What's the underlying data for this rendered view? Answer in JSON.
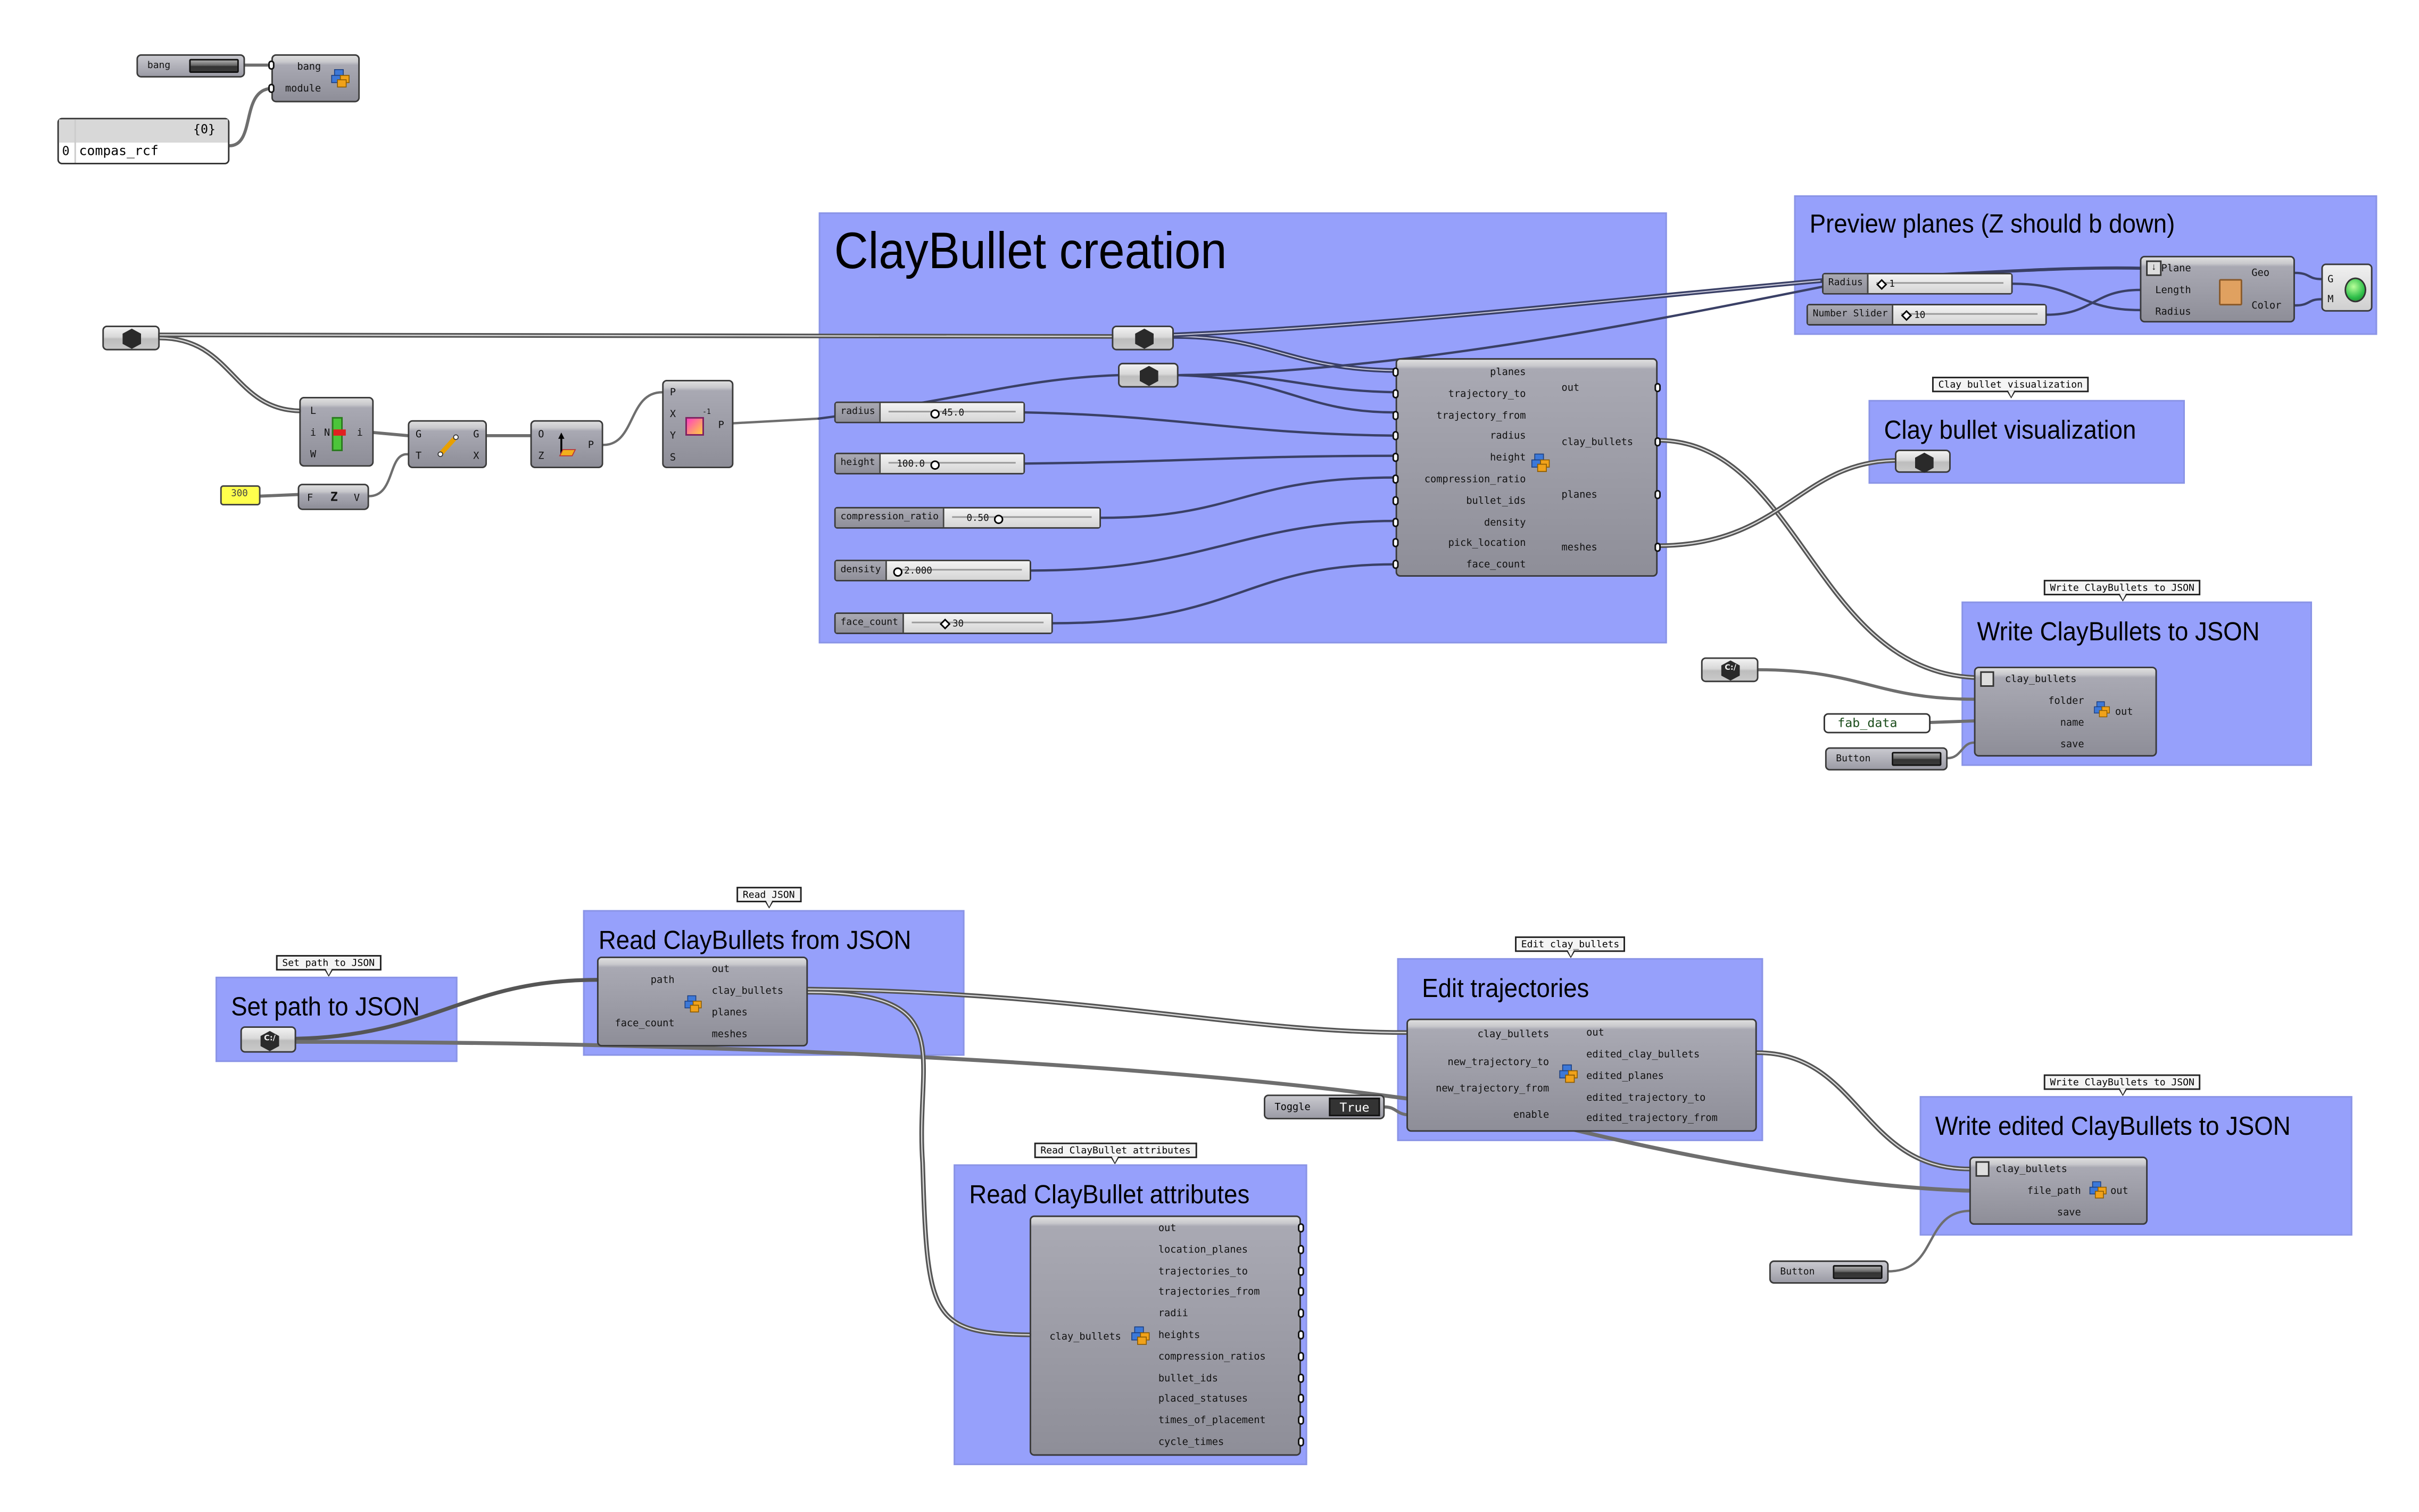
{
  "canvas": {
    "group_color": "#96a0fb",
    "wire_color": "#3a4066",
    "wire_color_outside": "#6e6e6e"
  },
  "top_left": {
    "bang_button_label": "bang",
    "python_node": {
      "inputs": [
        "bang",
        "module"
      ]
    },
    "panel": {
      "header": "{0}",
      "index": "0",
      "value": "compas_rcf"
    }
  },
  "geometry_chain": {
    "list_item": {
      "inputs": [
        "L",
        "i",
        "W"
      ],
      "outputs": [
        "i"
      ],
      "center_glyph": "N"
    },
    "orient": {
      "inputs": [
        "G",
        "T"
      ],
      "outputs": [
        "G",
        "X"
      ]
    },
    "plane": {
      "inputs": [
        "O",
        "Z"
      ],
      "outputs": [
        "P"
      ]
    },
    "adjust_plane": {
      "inputs": [
        "P",
        "X",
        "Y",
        "S"
      ],
      "outputs": [
        "P"
      ],
      "badge": "-1"
    },
    "unit_z": {
      "inputs": [
        "F"
      ],
      "outputs": [
        "V"
      ],
      "glyph": "Z"
    },
    "number_panel_value": "300"
  },
  "groups": {
    "claybullet_creation": {
      "title": "ClayBullet creation",
      "sliders": [
        {
          "name": "radius",
          "value": "45.0",
          "marker": "knob"
        },
        {
          "name": "height",
          "value": "100.0",
          "marker": "knob"
        },
        {
          "name": "compression_ratio",
          "value": "0.50",
          "marker": "knob"
        },
        {
          "name": "density",
          "value": "2.000",
          "marker": "knob"
        },
        {
          "name": "face_count",
          "value": "30",
          "marker": "diamond"
        }
      ],
      "python_node": {
        "inputs": [
          "planes",
          "trajectory_to",
          "trajectory_from",
          "radius",
          "height",
          "compression_ratio",
          "bullet_ids",
          "density",
          "pick_location",
          "face_count"
        ],
        "outputs": [
          "out",
          "clay_bullets",
          "planes",
          "meshes"
        ]
      }
    },
    "preview_planes": {
      "title": "Preview planes (Z should b down)",
      "sliders": [
        {
          "name": "Radius",
          "value": "1",
          "marker": "diamond"
        },
        {
          "name": "Number Slider",
          "value": "10",
          "marker": "diamond"
        }
      ],
      "display_node": {
        "inputs": [
          "Plane",
          "Length",
          "Radius"
        ],
        "outputs": [
          "Geo",
          "Color"
        ]
      },
      "custom_preview": {
        "inputs": [
          "G",
          "M"
        ]
      }
    },
    "clay_bullet_visualization": {
      "bubble": "Clay bullet visualization",
      "title": "Clay bullet visualization"
    },
    "write_claybullets": {
      "bubble": "Write ClayBullets to JSON",
      "title": "Write ClayBullets to JSON",
      "python_node": {
        "inputs": [
          "clay_bullets",
          "folder",
          "name",
          "save"
        ],
        "outputs": [
          "out"
        ]
      },
      "path_param_label": "C:/",
      "name_panel_value": "fab_data",
      "button_label": "Button"
    },
    "set_path": {
      "bubble": "Set path to JSON",
      "title": "Set path to JSON",
      "path_param_label": "C:/"
    },
    "read_json": {
      "bubble": "Read JSON",
      "title": "Read ClayBullets from JSON",
      "python_node": {
        "inputs": [
          "path",
          "face_count"
        ],
        "outputs": [
          "out",
          "clay_bullets",
          "planes",
          "meshes"
        ]
      }
    },
    "edit_trajectories": {
      "bubble": "Edit clay_bullets",
      "title": "Edit trajectories",
      "python_node": {
        "inputs": [
          "clay_bullets",
          "new_trajectory_to",
          "new_trajectory_from",
          "enable"
        ],
        "outputs": [
          "out",
          "edited_clay_bullets",
          "edited_planes",
          "edited_trajectory_to",
          "edited_trajectory_from"
        ]
      },
      "toggle": {
        "label": "Toggle",
        "value": "True"
      }
    },
    "write_edited": {
      "bubble": "Write ClayBullets to JSON",
      "title": "Write edited ClayBullets to JSON",
      "python_node": {
        "inputs": [
          "clay_bullets",
          "file_path",
          "save"
        ],
        "outputs": [
          "out"
        ]
      },
      "button_label": "Button"
    },
    "read_attributes": {
      "bubble": "Read ClayBullet attributes",
      "title": "Read ClayBullet attributes",
      "python_node": {
        "inputs": [
          "clay_bullets"
        ],
        "outputs": [
          "out",
          "location_planes",
          "trajectories_to",
          "trajectories_from",
          "radii",
          "heights",
          "compression_ratios",
          "bullet_ids",
          "placed_statuses",
          "times_of_placement",
          "cycle_times"
        ]
      }
    }
  }
}
